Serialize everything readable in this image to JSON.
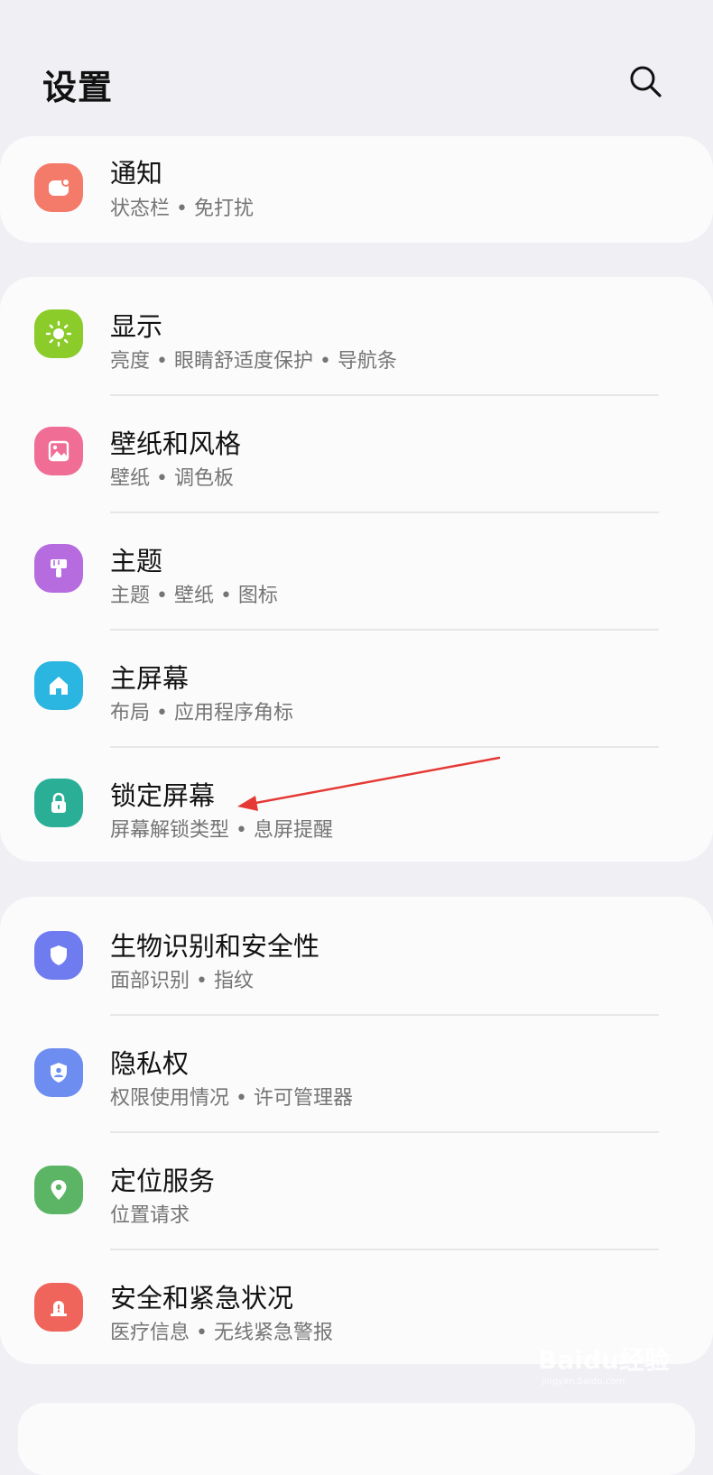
{
  "header": {
    "title": "设置",
    "search_icon": "search-icon"
  },
  "colors": {
    "notifications": "#f47a6a",
    "display": "#8bcb2a",
    "wallpaper": "#f06d96",
    "themes": "#b66cde",
    "home": "#2ab6e0",
    "lock": "#2aaf96",
    "biometrics": "#6f7cf0",
    "privacy": "#6e8df0",
    "location": "#5cb565",
    "safety": "#f0655b",
    "annotation_arrow": "#e53935"
  },
  "groups": [
    {
      "items": [
        {
          "title": "通知",
          "subtitle": "状态栏 • 免打扰",
          "icon": "notification-icon"
        }
      ]
    },
    {
      "items": [
        {
          "title": "显示",
          "subtitle": "亮度 • 眼睛舒适度保护 • 导航条",
          "icon": "sun-icon"
        },
        {
          "title": "壁纸和风格",
          "subtitle": "壁纸 • 调色板",
          "icon": "image-icon"
        },
        {
          "title": "主题",
          "subtitle": "主题 • 壁纸 • 图标",
          "icon": "brush-icon"
        },
        {
          "title": "主屏幕",
          "subtitle": "布局 • 应用程序角标",
          "icon": "home-icon"
        },
        {
          "title": "锁定屏幕",
          "subtitle": "屏幕解锁类型 • 息屏提醒",
          "icon": "lock-icon"
        }
      ]
    },
    {
      "items": [
        {
          "title": "生物识别和安全性",
          "subtitle": "面部识别 • 指纹",
          "icon": "shield-icon"
        },
        {
          "title": "隐私权",
          "subtitle": "权限使用情况 • 许可管理器",
          "icon": "privacy-shield-icon"
        },
        {
          "title": "定位服务",
          "subtitle": "位置请求",
          "icon": "location-pin-icon"
        },
        {
          "title": "安全和紧急状况",
          "subtitle": "医疗信息 • 无线紧急警报",
          "icon": "emergency-icon"
        }
      ]
    }
  ],
  "watermark": {
    "main": "Baidu经验",
    "sub": "jingyan.baidu.com"
  }
}
